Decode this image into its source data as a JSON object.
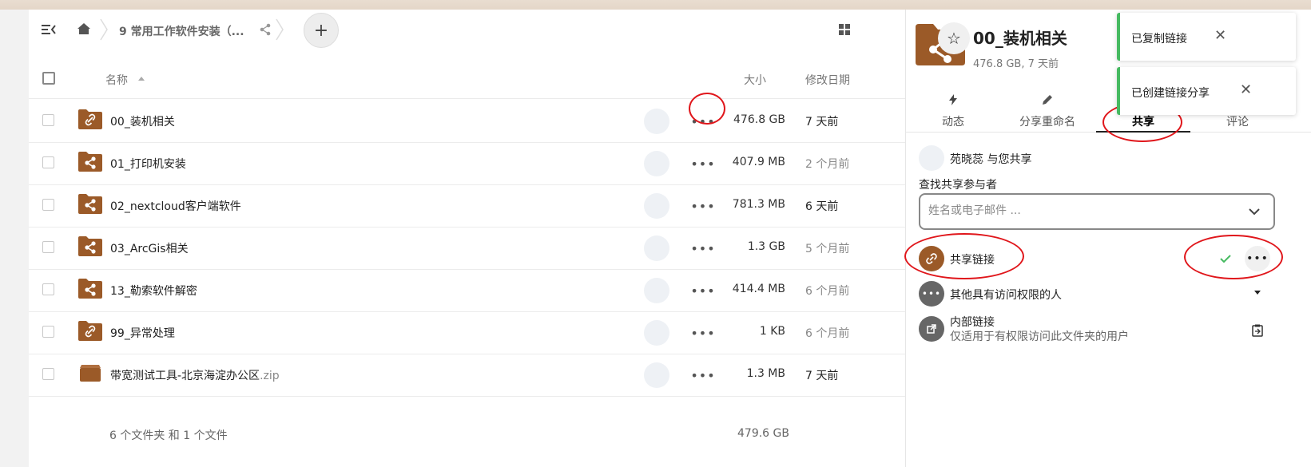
{
  "toolbar": {
    "breadcrumb_text": "9 常用工作软件安装（...",
    "add_label": "+"
  },
  "table": {
    "col_name": "名称",
    "col_size": "大小",
    "col_modified": "修改日期",
    "rows": [
      {
        "name": "00_装机相关",
        "ext": "",
        "size": "476.8 GB",
        "date": "7 天前",
        "icon": "link-folder-icon"
      },
      {
        "name": "01_打印机安装",
        "ext": "",
        "size": "407.9 MB",
        "date": "2 个月前",
        "icon": "shared-folder-icon"
      },
      {
        "name": "02_nextcloud客户端软件",
        "ext": "",
        "size": "781.3 MB",
        "date": "6 天前",
        "icon": "shared-folder-icon"
      },
      {
        "name": "03_ArcGis相关",
        "ext": "",
        "size": "1.3 GB",
        "date": "5 个月前",
        "icon": "shared-folder-icon"
      },
      {
        "name": "13_勒索软件解密",
        "ext": "",
        "size": "414.4 MB",
        "date": "6 个月前",
        "icon": "shared-folder-icon"
      },
      {
        "name": "99_异常处理",
        "ext": "",
        "size": "1 KB",
        "date": "6 个月前",
        "icon": "link-folder-icon"
      },
      {
        "name": "带宽测试工具-北京海淀办公区",
        "ext": ".zip",
        "size": "1.3 MB",
        "date": "7 天前",
        "icon": "zip-file-icon"
      }
    ],
    "summary_count": "6 个文件夹 和 1 个文件",
    "summary_size": "479.6 GB"
  },
  "sidebar": {
    "title": "00_装机相关",
    "subtitle": "476.8 GB, 7 天前",
    "tabs": [
      {
        "label": "动态",
        "icon": "lightning-icon"
      },
      {
        "label": "分享重命名",
        "icon": "pencil-icon"
      },
      {
        "label": "共享",
        "icon": ""
      },
      {
        "label": "评论",
        "icon": ""
      }
    ],
    "shared_by": "苑晓蕊 与您共享",
    "find_label": "查找共享参与者",
    "search_placeholder": "姓名或电子邮件 ...",
    "share_link_label": "共享链接",
    "others_label": "其他具有访问权限的人",
    "internal_link_label": "内部链接",
    "internal_link_desc": "仅适用于有权限访问此文件夹的用户"
  },
  "toasts": [
    {
      "text": "已复制链接"
    },
    {
      "text": "已创建链接分享"
    }
  ],
  "colors": {
    "folder_brown": "#9b5a28",
    "accent_green": "#46ba61",
    "annotation_red": "#e0161b"
  }
}
